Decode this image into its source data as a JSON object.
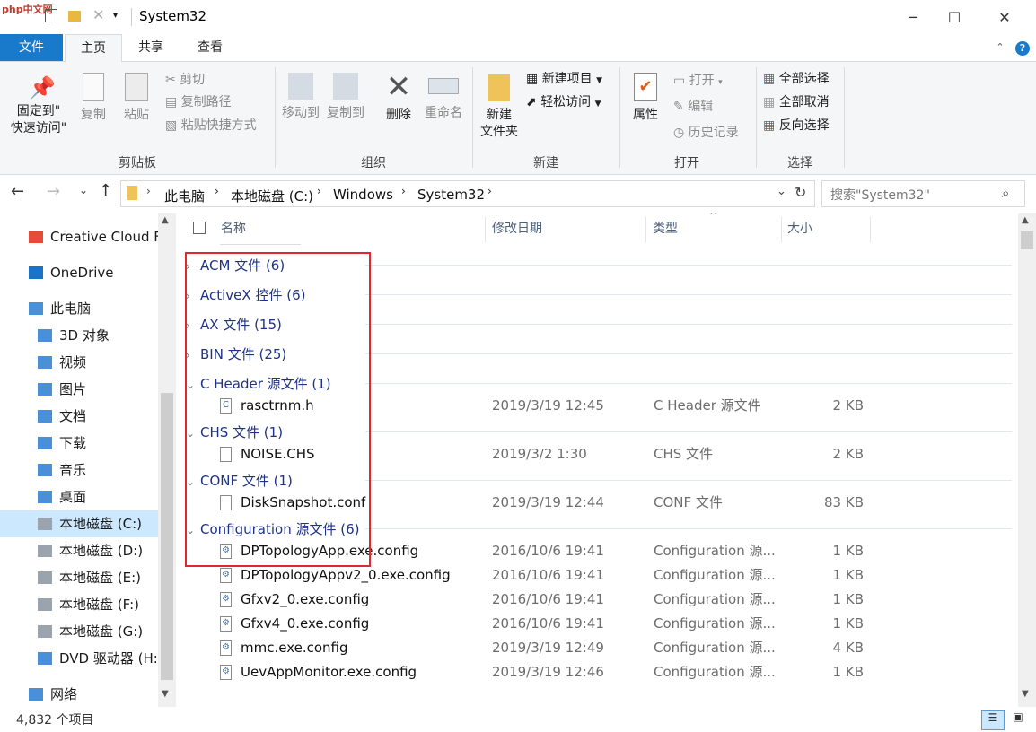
{
  "window": {
    "title": "System32",
    "minimize": "─",
    "maximize": "☐",
    "close": "✕",
    "watermark": "php中文网"
  },
  "ribbon_tabs": [
    "文件",
    "主页",
    "共享",
    "查看"
  ],
  "ribbon": {
    "clipboard": {
      "pin_line1": "固定到\"",
      "pin_line2": "快速访问\"",
      "copy": "复制",
      "paste": "粘贴",
      "cut": "剪切",
      "copy_path": "复制路径",
      "paste_shortcut": "粘贴快捷方式",
      "label": "剪贴板"
    },
    "organize": {
      "move_to": "移动到",
      "copy_to": "复制到",
      "delete": "删除",
      "rename": "重命名",
      "label": "组织"
    },
    "new": {
      "new_folder_line1": "新建",
      "new_folder_line2": "文件夹",
      "new_item": "新建项目",
      "easy_access": "轻松访问",
      "label": "新建"
    },
    "open": {
      "properties": "属性",
      "open": "打开",
      "edit": "编辑",
      "history": "历史记录",
      "label": "打开"
    },
    "select": {
      "select_all": "全部选择",
      "select_none": "全部取消",
      "invert": "反向选择",
      "label": "选择"
    }
  },
  "address": {
    "crumbs": [
      "此电脑",
      "本地磁盘 (C:)",
      "Windows",
      "System32"
    ],
    "search_placeholder": "搜索\"System32\""
  },
  "nav": [
    {
      "label": "Creative Cloud F",
      "icon": "creative-cloud-icon"
    },
    {
      "label": "OneDrive",
      "icon": "onedrive-icon"
    },
    {
      "label": "此电脑",
      "icon": "pc-icon"
    },
    {
      "label": "3D 对象",
      "icon": "3d-objects-icon"
    },
    {
      "label": "视频",
      "icon": "video-icon"
    },
    {
      "label": "图片",
      "icon": "pictures-icon"
    },
    {
      "label": "文档",
      "icon": "documents-icon"
    },
    {
      "label": "下载",
      "icon": "download-icon"
    },
    {
      "label": "音乐",
      "icon": "music-icon"
    },
    {
      "label": "桌面",
      "icon": "desktop-icon"
    },
    {
      "label": "本地磁盘 (C:)",
      "icon": "drive-icon",
      "selected": true
    },
    {
      "label": "本地磁盘 (D:)",
      "icon": "drive-icon"
    },
    {
      "label": "本地磁盘 (E:)",
      "icon": "drive-icon"
    },
    {
      "label": "本地磁盘 (F:)",
      "icon": "drive-icon"
    },
    {
      "label": "本地磁盘 (G:)",
      "icon": "drive-icon"
    },
    {
      "label": "DVD 驱动器 (H:)",
      "icon": "dvd-icon"
    },
    {
      "label": "网络",
      "icon": "network-icon"
    }
  ],
  "columns": {
    "name": "名称",
    "date": "修改日期",
    "type": "类型",
    "size": "大小"
  },
  "groups": [
    {
      "label": "ACM 文件 (6)",
      "expanded": false,
      "files": []
    },
    {
      "label": "ActiveX 控件 (6)",
      "expanded": false,
      "files": []
    },
    {
      "label": "AX 文件 (15)",
      "expanded": false,
      "files": []
    },
    {
      "label": "BIN 文件 (25)",
      "expanded": false,
      "files": []
    },
    {
      "label": "C Header 源文件 (1)",
      "expanded": true,
      "files": [
        {
          "name": "rasctrnm.h",
          "date": "2019/3/19 12:45",
          "type": "C Header 源文件",
          "size": "2 KB",
          "icon": "c-header-file-icon"
        }
      ]
    },
    {
      "label": "CHS 文件 (1)",
      "expanded": true,
      "files": [
        {
          "name": "NOISE.CHS",
          "date": "2019/3/2 1:30",
          "type": "CHS 文件",
          "size": "2 KB",
          "icon": "file-icon"
        }
      ]
    },
    {
      "label": "CONF 文件 (1)",
      "expanded": true,
      "files": [
        {
          "name": "DiskSnapshot.conf",
          "date": "2019/3/19 12:44",
          "type": "CONF 文件",
          "size": "83 KB",
          "icon": "file-icon"
        }
      ]
    },
    {
      "label": "Configuration 源文件 (6)",
      "expanded": true,
      "files": [
        {
          "name": "DPTopologyApp.exe.config",
          "date": "2016/10/6 19:41",
          "type": "Configuration 源...",
          "size": "1 KB",
          "icon": "config-file-icon"
        },
        {
          "name": "DPTopologyAppv2_0.exe.config",
          "date": "2016/10/6 19:41",
          "type": "Configuration 源...",
          "size": "1 KB",
          "icon": "config-file-icon"
        },
        {
          "name": "Gfxv2_0.exe.config",
          "date": "2016/10/6 19:41",
          "type": "Configuration 源...",
          "size": "1 KB",
          "icon": "config-file-icon"
        },
        {
          "name": "Gfxv4_0.exe.config",
          "date": "2016/10/6 19:41",
          "type": "Configuration 源...",
          "size": "1 KB",
          "icon": "config-file-icon"
        },
        {
          "name": "mmc.exe.config",
          "date": "2019/3/19 12:49",
          "type": "Configuration 源...",
          "size": "4 KB",
          "icon": "config-file-icon"
        },
        {
          "name": "UevAppMonitor.exe.config",
          "date": "2019/3/19 12:46",
          "type": "Configuration 源...",
          "size": "1 KB",
          "icon": "config-file-icon"
        }
      ]
    }
  ],
  "status": {
    "item_count": "4,832 个项目"
  },
  "colors": {
    "accent": "#1979ca",
    "group_text": "#1e3287",
    "highlight": "#e0282d",
    "selected": "#cce8ff"
  }
}
